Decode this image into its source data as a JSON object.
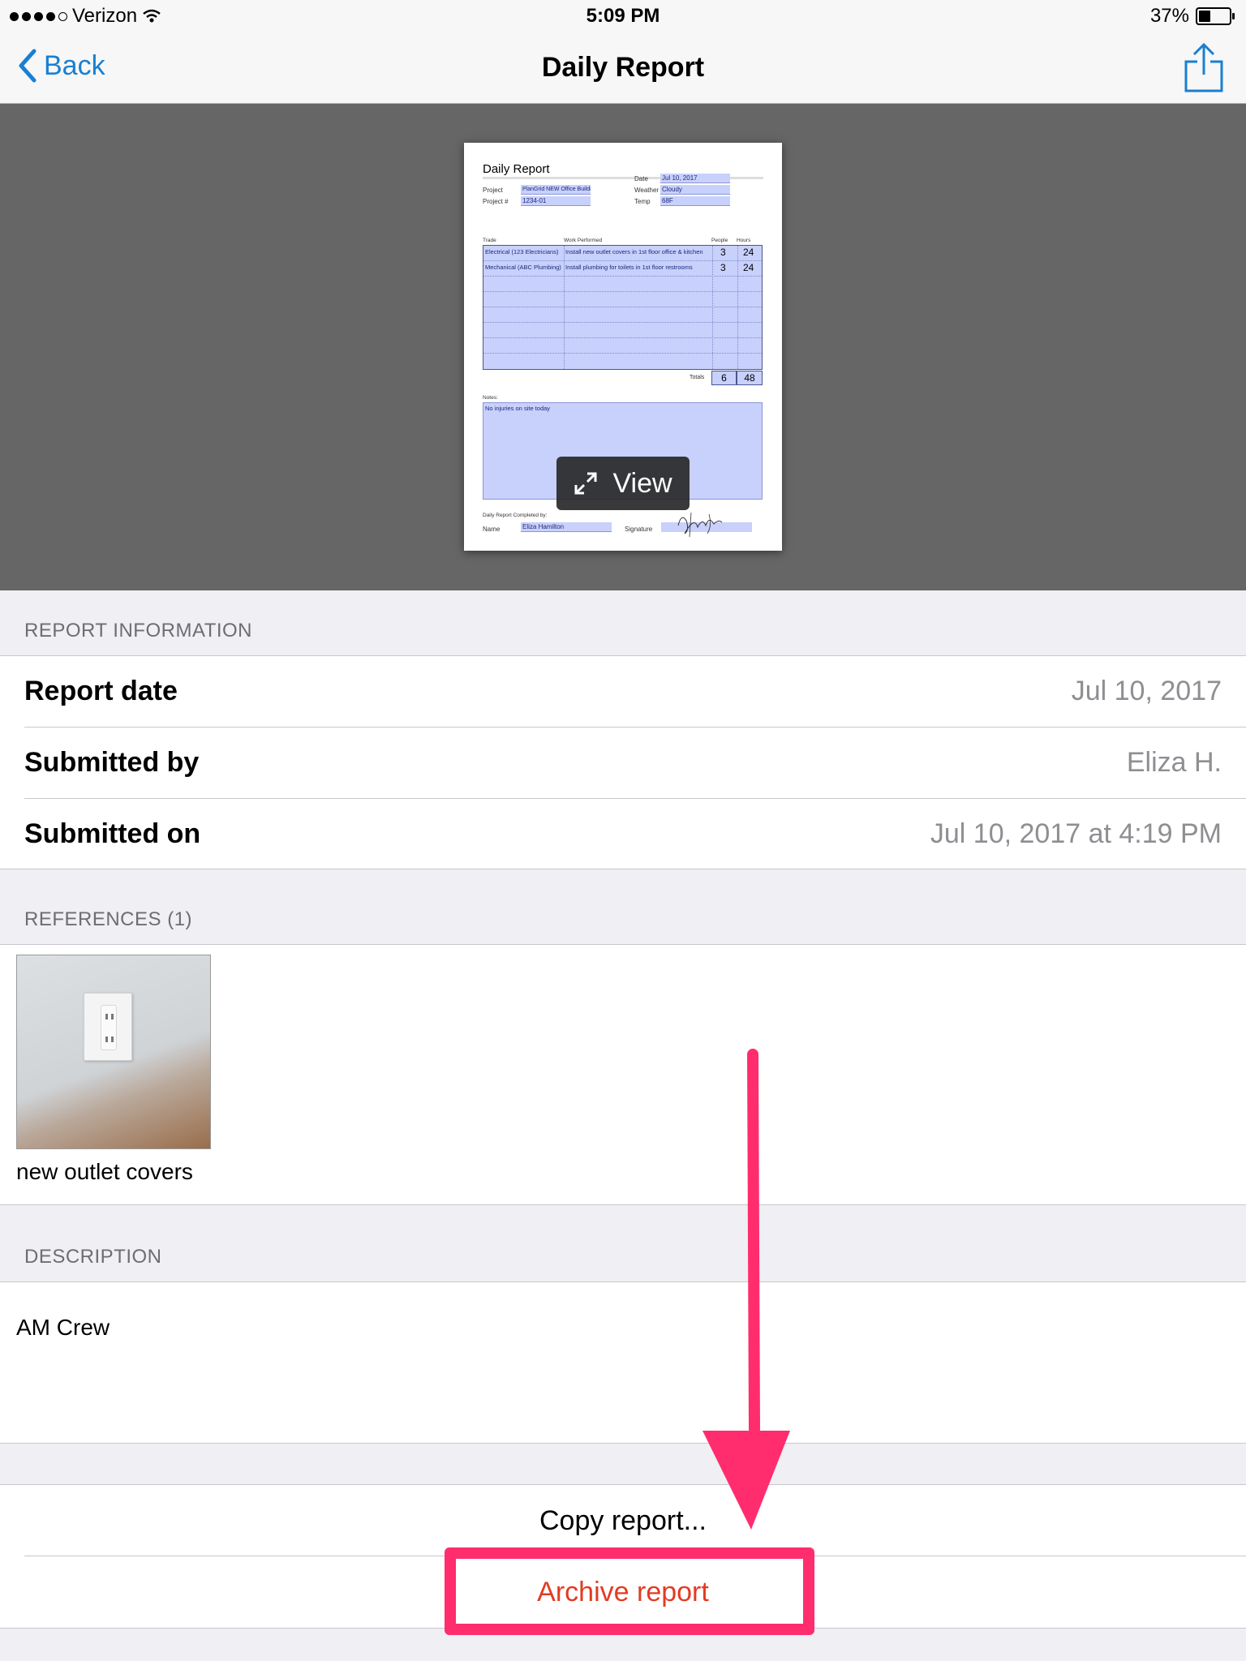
{
  "status_bar": {
    "carrier": "Verizon",
    "time": "5:09 PM",
    "battery": "37%",
    "battery_level": 0.37
  },
  "nav": {
    "back_label": "Back",
    "title": "Daily Report",
    "share_icon": "share-icon"
  },
  "document_preview": {
    "title": "Daily Report",
    "date_label": "Date",
    "date_value": "Jul 10, 2017",
    "project_label": "Project",
    "project_value": "PlanGrid NEW Office Building",
    "weather_label": "Weather",
    "weather_value": "Cloudy",
    "project_no_label": "Project #",
    "project_no_value": "1234-01",
    "temp_label": "Temp",
    "temp_value": "68F",
    "col_trade": "Trade",
    "col_work": "Work Performed",
    "col_people": "People",
    "col_hours": "Hours",
    "rows": [
      {
        "trade": "Electrical (123 Electricians)",
        "work": "Install new outlet covers in 1st floor office & kitchen",
        "people": "3",
        "hours": "24"
      },
      {
        "trade": "Mechanical (ABC Plumbing)",
        "work": "Install plumbing for toilets in 1st floor restrooms",
        "people": "3",
        "hours": "24"
      }
    ],
    "totals_label": "Totals",
    "totals_people": "6",
    "totals_hours": "48",
    "notes_label": "Notes:",
    "notes_value": "No injuries on site today",
    "completed_by_label": "Daily Report Completed by:",
    "name_label": "Name",
    "name_value": "Eliza Hamilton",
    "signature_label": "Signature",
    "view_label": "View"
  },
  "report_info": {
    "header": "REPORT INFORMATION",
    "rows": [
      {
        "label": "Report date",
        "value": "Jul 10, 2017"
      },
      {
        "label": "Submitted by",
        "value": "Eliza H."
      },
      {
        "label": "Submitted on",
        "value": "Jul 10, 2017 at 4:19 PM"
      }
    ]
  },
  "references": {
    "header": "REFERENCES (1)",
    "items": [
      {
        "caption": "new outlet covers"
      }
    ]
  },
  "description": {
    "header": "DESCRIPTION",
    "text": "AM Crew"
  },
  "actions": {
    "copy_label": "Copy report...",
    "archive_label": "Archive report"
  },
  "colors": {
    "accent": "#1a7fd1",
    "destructive": "#e33b22",
    "highlight": "#ff2d6e"
  }
}
